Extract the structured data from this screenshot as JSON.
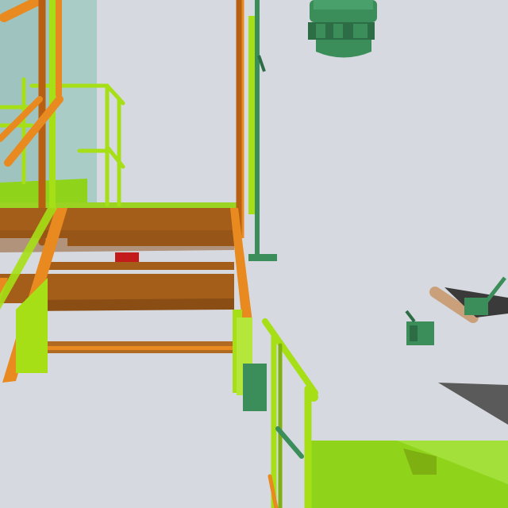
{
  "scene": {
    "colors": {
      "background": "#d7d9e0",
      "pipe_orange": "#e88a1f",
      "pipe_orange_dark": "#b85f12",
      "railing_yellow_green": "#a6df16",
      "railing_shadow": "#7fb012",
      "stair_brown": "#a45e1a",
      "stair_brown_dark": "#8a4d14",
      "equipment_green": "#3b8e5a",
      "equipment_green_dark": "#2d6d45",
      "wall_teal": "#9fc4bf",
      "floor_lime": "#8fd41a",
      "shadow_dark": "#3a3a3a",
      "tan_pipe": "#c9a07a",
      "red_block": "#c31b1b"
    },
    "objects": [
      "vertical-orange-pipe",
      "diagonal-orange-pipe",
      "metal-stairs",
      "safety-railing",
      "green-motor-housing",
      "green-valves",
      "lime-platform"
    ]
  }
}
